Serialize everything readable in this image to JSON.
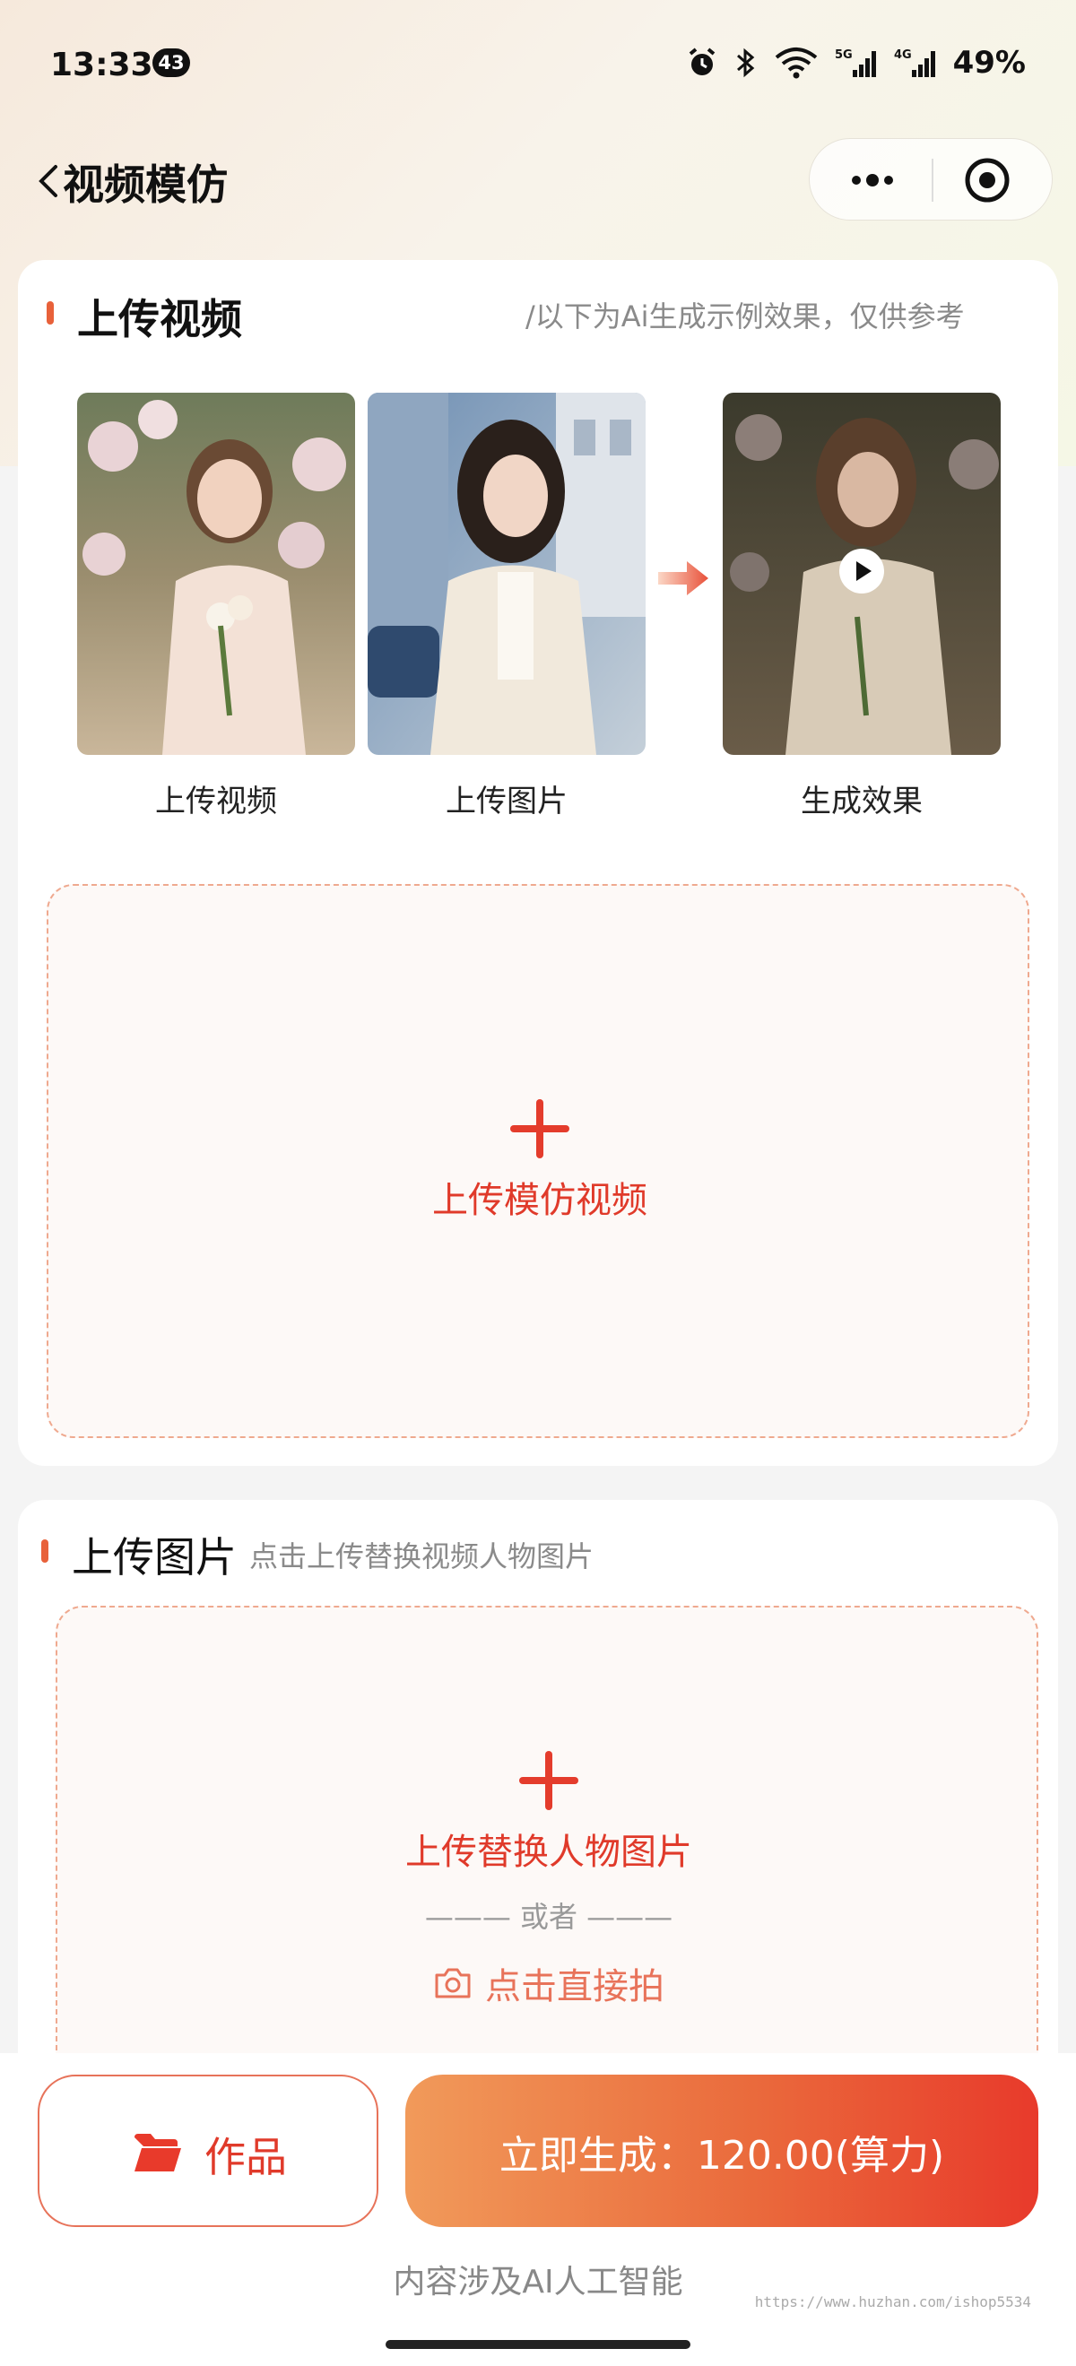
{
  "status_bar": {
    "time": "13:33",
    "notification_count": "43",
    "battery": "49%"
  },
  "nav": {
    "title": "视频模仿"
  },
  "upload_video_section": {
    "title": "上传视频",
    "note": "/以下为Ai生成示例效果，仅供参考",
    "samples": [
      {
        "caption": "上传视频"
      },
      {
        "caption": "上传图片"
      },
      {
        "caption": "生成效果"
      }
    ],
    "upload_label": "上传模仿视频"
  },
  "upload_image_section": {
    "title": "上传图片",
    "note": "点击上传替换视频人物图片",
    "upload_label": "上传替换人物图片",
    "divider": "——— 或者 ———",
    "shoot_label": "点击直接拍"
  },
  "bottom": {
    "works_label": "作品",
    "generate_label": "立即生成：120.00(算力)",
    "ai_note": "内容涉及AI人工智能",
    "watermark": "https://www.huzhan.com/ishop5534"
  },
  "colors": {
    "accent": "#e43c2c",
    "gradient_start": "#f19a5a",
    "gradient_end": "#e83a2b"
  }
}
